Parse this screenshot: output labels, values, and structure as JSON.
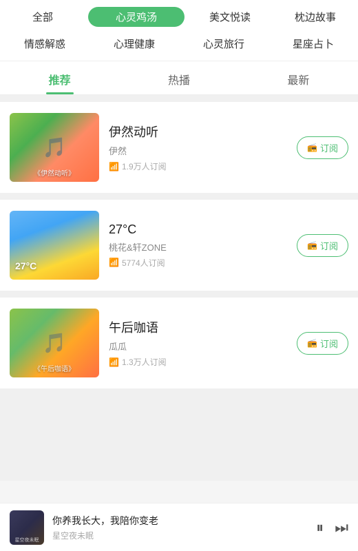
{
  "categories_row1": [
    {
      "label": "全部",
      "active": false
    },
    {
      "label": "心灵鸡汤",
      "active": true
    },
    {
      "label": "美文悦读",
      "active": false
    },
    {
      "label": "枕边故事",
      "active": false
    }
  ],
  "categories_row2": [
    {
      "label": "情感解惑",
      "active": false
    },
    {
      "label": "心理健康",
      "active": false
    },
    {
      "label": "心灵旅行",
      "active": false
    },
    {
      "label": "星座占卜",
      "active": false
    }
  ],
  "main_tabs": [
    {
      "label": "推荐",
      "active": true
    },
    {
      "label": "热播",
      "active": false
    },
    {
      "label": "最新",
      "active": false
    }
  ],
  "podcasts": [
    {
      "title": "伊然动听",
      "author": "伊然",
      "subscribers": "1.9万人订阅",
      "thumb_label": "《伊然动听》",
      "btn_label": "订阅",
      "thumb_type": "1"
    },
    {
      "title": "27°C",
      "author": "桃花&轩ZONE",
      "subscribers": "5774人订阅",
      "thumb_label": "27°C",
      "btn_label": "订阅",
      "thumb_type": "2"
    },
    {
      "title": "午后咖语",
      "author": "瓜瓜",
      "subscribers": "1.3万人订阅",
      "thumb_label": "《午后咖语》",
      "btn_label": "订阅",
      "thumb_type": "3"
    }
  ],
  "player": {
    "title": "你养我长大，我陪你变老",
    "subtitle": "星空夜未眠",
    "thumb_text": "星空夜未眠"
  },
  "icons": {
    "subscribe_bell": "📻",
    "pause": "⏸",
    "next": "⏭",
    "wifi": "📶"
  }
}
